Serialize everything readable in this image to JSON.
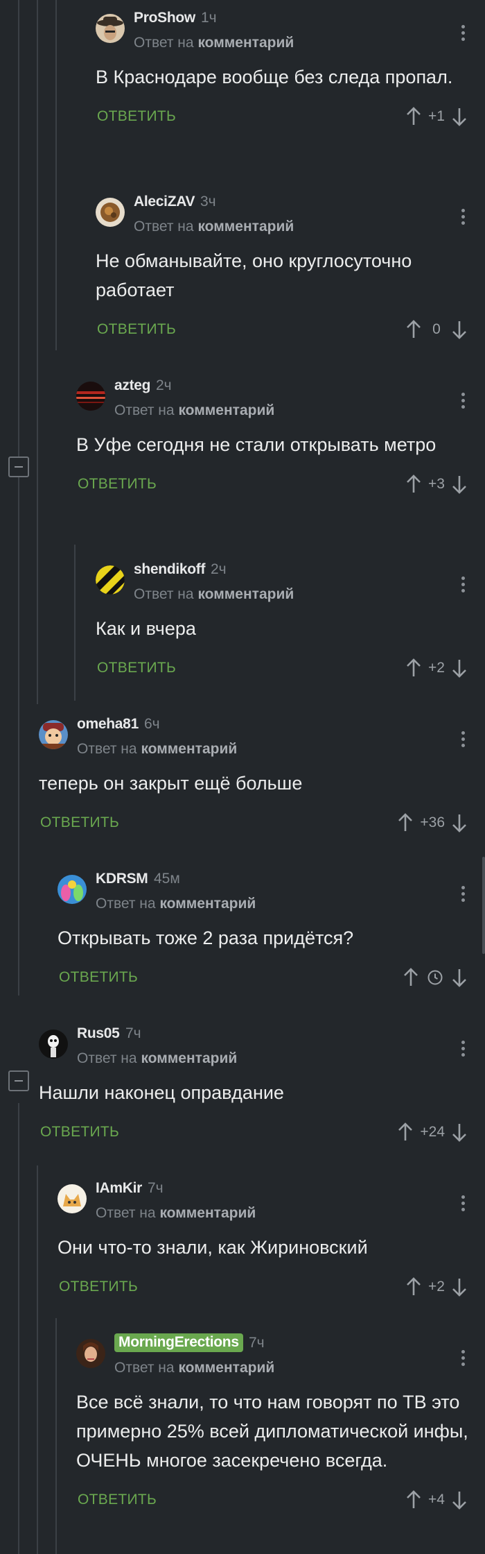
{
  "ui": {
    "reply_label": "ОТВЕТИТЬ",
    "reply_to_prefix": "Ответ на",
    "reply_to_target": "комментарий"
  },
  "colors": {
    "background": "#23272b",
    "accent_green": "#6aa84f",
    "muted_text": "#7e848a",
    "thread_line": "#3b4046"
  },
  "comments": [
    {
      "author": "ProShow",
      "time": "1ч",
      "text": "В Краснодаре вообще без следа пропал.",
      "score": "+1",
      "avatar_icon": "cowboy-avatar-icon"
    },
    {
      "author": "AleciZAV",
      "time": "3ч",
      "text": "Не обманывайте, оно круглосуточно работает",
      "score": "0",
      "avatar_icon": "dish-avatar-icon"
    },
    {
      "author": "azteg",
      "time": "2ч",
      "text": "В Уфе сегодня не стали открывать метро",
      "score": "+3",
      "avatar_icon": "dark-red-avatar-icon"
    },
    {
      "author": "shendikoff",
      "time": "2ч",
      "text": "Как и вчера",
      "score": "+2",
      "avatar_icon": "striped-avatar-icon"
    },
    {
      "author": "omeha81",
      "time": "6ч",
      "text": "теперь он закрыт ещё больше",
      "score": "+36",
      "avatar_icon": "cartoon-avatar-icon"
    },
    {
      "author": "KDRSM",
      "time": "45м",
      "text": "Открывать тоже 2 раза придётся?",
      "score": "",
      "avatar_icon": "colorful-avatar-icon",
      "score_icon": "clock-icon"
    },
    {
      "author": "Rus05",
      "time": "7ч",
      "text": "Нашли наконец оправдание",
      "score": "+24",
      "avatar_icon": "skeleton-avatar-icon"
    },
    {
      "author": "IAmKir",
      "time": "7ч",
      "text": "Они что-то знали, как Жириновский",
      "score": "+2",
      "avatar_icon": "cat-avatar-icon"
    },
    {
      "author": "MorningErections",
      "time": "7ч",
      "text": "Все всё знали, то что нам говорят по ТВ это примерно 25% всей дипломатической инфы, ОЧЕНЬ многое засекречено всегда.",
      "score": "+4",
      "avatar_icon": "woman-avatar-icon",
      "author_badge": true
    }
  ]
}
